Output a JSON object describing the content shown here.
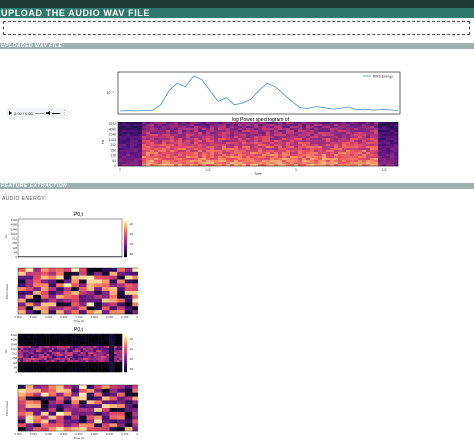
{
  "header": {
    "title": "UPLOAD THE AUDIO WAV FILE"
  },
  "uploaded_section": {
    "title": "UPLOADED WAV FILE:"
  },
  "audio_player": {
    "time": "0:00 / 0:00"
  },
  "feature_section": {
    "title": "FEATURE EXTRACTION"
  },
  "audio_energy_label": "AUDIO ENERGY:",
  "chart_data": [
    {
      "type": "line",
      "series": [
        {
          "name": "RMS Energy",
          "values": [
            0.03,
            0.035,
            0.03,
            0.04,
            0.05,
            0.2,
            0.6,
            0.8,
            0.7,
            1.0,
            0.9,
            0.6,
            0.3,
            0.4,
            0.2,
            0.25,
            0.35,
            0.6,
            0.8,
            0.7,
            0.5,
            0.3,
            0.12,
            0.1,
            0.15,
            0.12,
            0.08,
            0.1,
            0.14,
            0.06,
            0.08,
            0.05,
            0.07,
            0.06,
            0.04
          ]
        }
      ],
      "ytick": "10⁻¹",
      "legend": "top-right",
      "color": "#4c8fc7"
    },
    {
      "type": "heatmap",
      "title": "log Power spectrogram of",
      "xlabel": "Time",
      "ylabel": "Hz",
      "yticks": [
        "8192",
        "4096",
        "2048",
        "1024",
        "512",
        "256",
        "128",
        "64",
        "0"
      ],
      "xticks": [
        "0",
        "0.5",
        "1",
        "1.5"
      ]
    },
    {
      "type": "heatmap",
      "title": "P0,t",
      "ylabel": "Hz",
      "yticks": [
        "8192",
        "4096",
        "2048",
        "1024",
        "512",
        "256",
        "128",
        "64",
        "0"
      ],
      "colorbar_ticks": [
        "-20",
        "-40",
        "-60",
        "-80"
      ],
      "empty": true
    },
    {
      "type": "heatmap",
      "ylabel": "Pitch Class",
      "xlabel": "Time (s)",
      "xticks": [
        "0.000",
        "0.100",
        "0.200",
        "0.300",
        "0.400",
        "0.500",
        "0.600",
        "0.700",
        "0.800"
      ]
    },
    {
      "type": "heatmap",
      "title": "P0,t",
      "ylabel": "Hz",
      "yticks": [
        "8192",
        "4096",
        "2048",
        "1024",
        "512",
        "256",
        "128",
        "64",
        "0"
      ],
      "colorbar_ticks": [
        "-20",
        "-40",
        "-60",
        "-80"
      ]
    },
    {
      "type": "heatmap",
      "ylabel": "Pitch Class",
      "xlabel": "Time (s)",
      "xticks": [
        "0.000",
        "0.100",
        "0.200",
        "0.300",
        "0.400",
        "0.500",
        "0.600",
        "0.700",
        "0.800"
      ]
    }
  ]
}
